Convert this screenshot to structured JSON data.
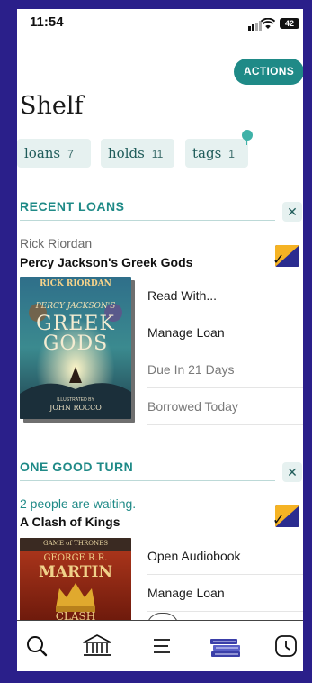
{
  "status": {
    "time": "11:54",
    "battery": "42"
  },
  "header": {
    "actions_label": "ACTIONS",
    "title": "Shelf"
  },
  "chips": [
    {
      "label": "loans",
      "count": "7"
    },
    {
      "label": "holds",
      "count": "11"
    },
    {
      "label": "tags",
      "count": "1"
    }
  ],
  "recent_loans": {
    "header": "RECENT LOANS",
    "author": "Rick Riordan",
    "title": "Percy Jackson's Greek Gods",
    "cover": {
      "line1": "RICK RIORDAN",
      "line2": "PERCY JACKSON'S",
      "line3": "GREEK",
      "line4": "GODS",
      "line5": "ILLUSTRATED BY",
      "line6": "JOHN ROCCO"
    },
    "options": [
      "Read With...",
      "Manage Loan",
      "Due In 21 Days",
      "Borrowed Today"
    ]
  },
  "good_turn": {
    "header": "ONE GOOD TURN",
    "waiting": "2 people are waiting.",
    "title": "A Clash of Kings",
    "cover": {
      "line1": "GAME of THRONES",
      "line2": "GEORGE R.R.",
      "line3": "MARTIN",
      "line4": "CLASH"
    },
    "options": [
      "Open Audiobook",
      "Manage Loan"
    ]
  },
  "icons": {
    "close": "close-icon",
    "check": "check-icon",
    "search": "search-icon",
    "library": "library-icon",
    "menu": "menu-icon",
    "shelf": "books-stack-icon",
    "history": "clock-icon"
  },
  "colors": {
    "accent": "#1f8a87",
    "chip_bg": "#e6f1f0",
    "frame": "#2a1f8a",
    "badge_navy": "#2a2c8f",
    "badge_gold": "#f5b324"
  }
}
